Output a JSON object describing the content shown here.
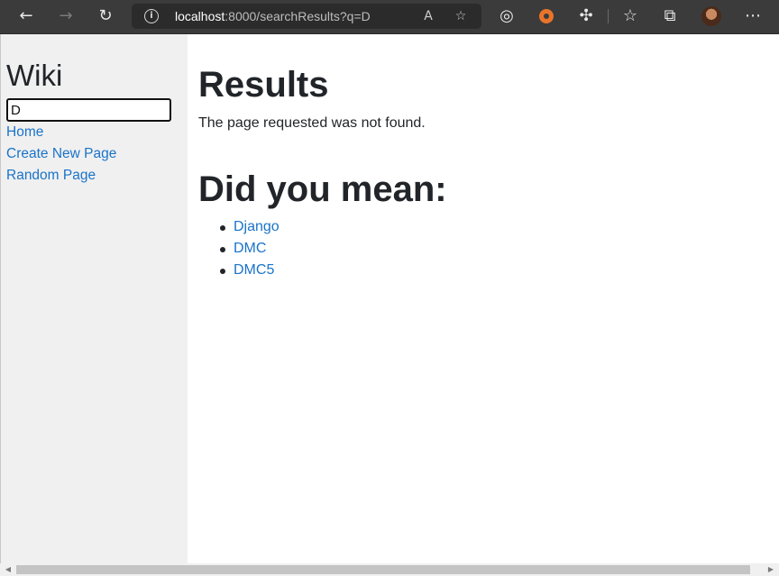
{
  "browser": {
    "url_host": "localhost",
    "url_rest": ":8000/searchResults?q=D",
    "icons": {
      "back": "back-arrow-icon",
      "forward": "forward-arrow-icon",
      "reload": "reload-icon",
      "info": "info-icon",
      "read_aloud": "read-aloud-icon",
      "add_favorite": "add-favorite-icon",
      "tracking": "tracking-prevention-icon",
      "extension": "orange-extension-icon",
      "extensions": "extensions-puzzle-icon",
      "favorites": "favorites-icon",
      "collections": "collections-icon",
      "profile": "profile-avatar",
      "menu": "more-menu-icon"
    }
  },
  "sidebar": {
    "title": "Wiki",
    "search_value": "D",
    "links": [
      {
        "label": "Home"
      },
      {
        "label": "Create New Page"
      },
      {
        "label": "Random Page"
      }
    ]
  },
  "main": {
    "heading": "Results",
    "message": "The page requested was not found.",
    "suggestion_heading": "Did you mean:",
    "suggestions": [
      {
        "label": "Django"
      },
      {
        "label": "DMC"
      },
      {
        "label": "DMC5"
      }
    ]
  },
  "colors": {
    "link": "#1a73c9",
    "sidebar_bg": "#f0f0f0",
    "toolbar_bg": "#3b3b3b",
    "text": "#212529"
  }
}
